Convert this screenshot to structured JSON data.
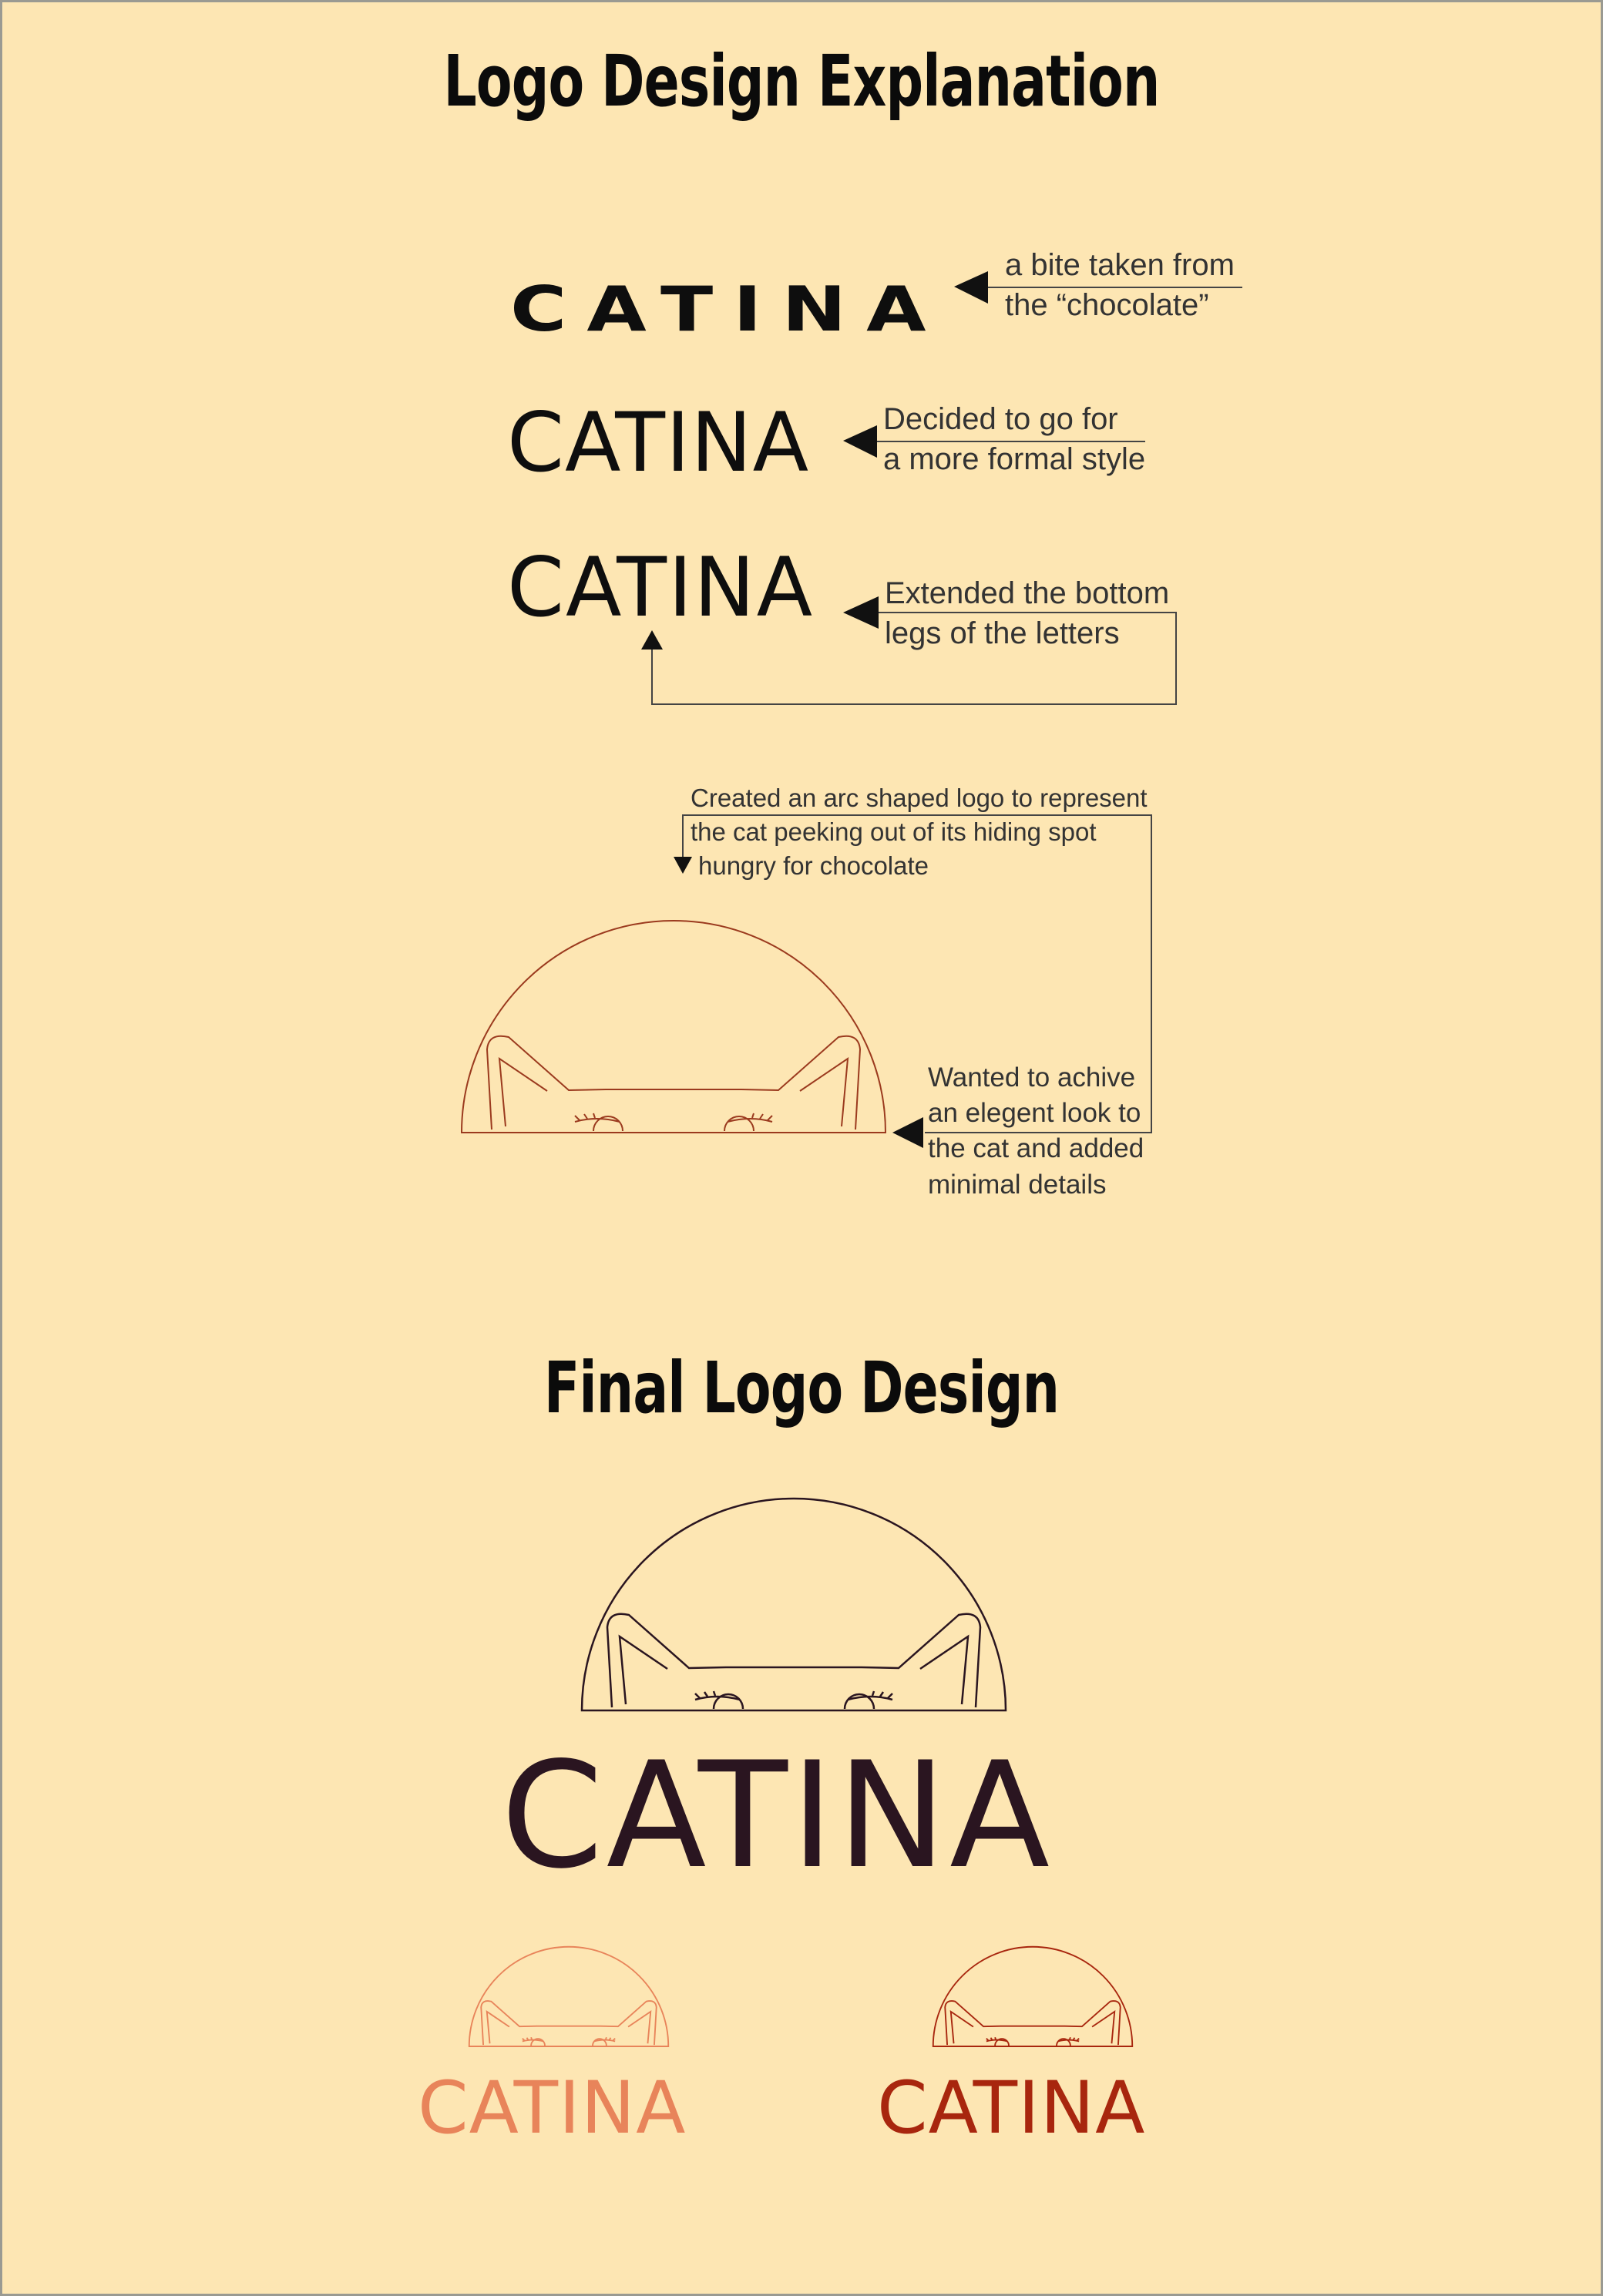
{
  "sections": {
    "explanation_title": "Logo Design Explanation",
    "final_title": "Final Logo Design"
  },
  "brand": {
    "name": "CATINA"
  },
  "steps": [
    {
      "wordmark": "CATINA",
      "note_line1": "a bite taken from",
      "note_line2": "the “chocolate”"
    },
    {
      "wordmark": "CATINA",
      "note_line1": "Decided to go for",
      "note_line2": "a more formal style"
    },
    {
      "wordmark": "CATINA",
      "note_line1": "Extended the bottom",
      "note_line2": "legs of the letters"
    }
  ],
  "arc_notes": {
    "top_line1": "Created an arc shaped logo to represent",
    "top_line2": "the cat peeking out of its hiding spot",
    "top_line3": "hungry for chocolate",
    "side_line1": "Wanted to achive",
    "side_line2": "an elegent look to",
    "side_line3": "the cat and added",
    "side_line4": "minimal details"
  },
  "colors": {
    "background": "#fde6b3",
    "sketch_line": "#9b3a1e",
    "final_dark": "#2a1520",
    "variant_salmon": "#e8845a",
    "variant_red": "#a8260e"
  }
}
